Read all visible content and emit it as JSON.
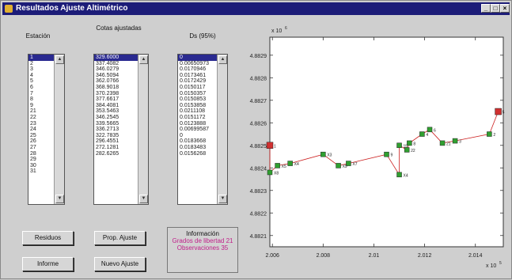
{
  "window": {
    "title": "Resultados Ajuste Altimétrico"
  },
  "labels": {
    "estacion": "Estación",
    "cotas": "Cotas ajustadas",
    "desv": "Ds (95%)"
  },
  "estacion_list": [
    "1",
    "2",
    "3",
    "4",
    "5",
    "6",
    "7",
    "8",
    "9",
    "21",
    "22",
    "23",
    "24",
    "25",
    "26",
    "27",
    "28",
    "29",
    "30",
    "31"
  ],
  "cotas_list": [
    "329.6000",
    "337.4082",
    "346.0279",
    "346.5094",
    "362.0766",
    "368.9018",
    "370.2398",
    "377.6617",
    "384.4081",
    "353.5463",
    "346.2545",
    "339.5665",
    "336.2713",
    "322.7835",
    "296.4551",
    "272.1281",
    "282.6265"
  ],
  "desv_list": [
    "0",
    "0.00650973",
    "0.0170946",
    "0.0173461",
    "0.0172429",
    "0.0150117",
    "0.0150357",
    "0.0150853",
    "0.0153858",
    "0.0211108",
    "0.0151172",
    "0.0123888",
    "0.00699587",
    "0",
    "0.0183668",
    "0.0183483",
    "0.0156268"
  ],
  "buttons": {
    "residuos": "Residuos",
    "prop_ajuste": "Prop. Ajuste",
    "informe": "Informe",
    "nuevo_ajuste": "Nuevo Ajuste"
  },
  "info": {
    "title": "Información",
    "line1": "Grados de libertad 21",
    "line2": "Observaciones 35"
  },
  "colors": {
    "info_text": "#c0208a",
    "fixed_point": "#d03030",
    "free_point": "#30a030",
    "line": "#cc2020"
  },
  "chart_data": {
    "type": "scatter",
    "x_multiplier_label": "x 10",
    "x_multiplier_exp": "5",
    "y_multiplier_label": "x 10",
    "y_multiplier_exp": "6",
    "xlim": [
      2.0059,
      2.0151
    ],
    "ylim": [
      4.88205,
      4.88298
    ],
    "x_ticks": [
      2.006,
      2.008,
      2.01,
      2.012,
      2.014
    ],
    "x_tick_labels": [
      "2.006",
      "2.008",
      "2.01",
      "2.012",
      "2.014"
    ],
    "y_ticks": [
      4.8821,
      4.8822,
      4.8823,
      4.8824,
      4.8825,
      4.8826,
      4.8827,
      4.8828,
      4.8829
    ],
    "y_tick_labels": [
      "4.8821",
      "4.8822",
      "4.8823",
      "4.8824",
      "4.8825",
      "4.8826",
      "4.8827",
      "4.8828",
      "4.8829"
    ],
    "points": [
      {
        "label": "5",
        "x": 2.0149,
        "y": 4.88265,
        "fixed": true
      },
      {
        "label": "2",
        "x": 2.01455,
        "y": 4.88255,
        "fixed": false
      },
      {
        "label": "3",
        "x": 2.0132,
        "y": 4.88252,
        "fixed": false
      },
      {
        "label": "21",
        "x": 2.0127,
        "y": 4.88251,
        "fixed": false
      },
      {
        "label": "6",
        "x": 2.0122,
        "y": 4.88257,
        "fixed": false
      },
      {
        "label": "4",
        "x": 2.0119,
        "y": 4.88255,
        "fixed": false
      },
      {
        "label": "8",
        "x": 2.0114,
        "y": 4.88251,
        "fixed": false
      },
      {
        "label": "22",
        "x": 2.0113,
        "y": 4.88248,
        "fixed": false
      },
      {
        "label": "15",
        "x": 2.011,
        "y": 4.8825,
        "fixed": false
      },
      {
        "label": "X4",
        "x": 2.011,
        "y": 4.88237,
        "fixed": false
      },
      {
        "label": "9",
        "x": 2.0105,
        "y": 4.88246,
        "fixed": false
      },
      {
        "label": "X7",
        "x": 2.009,
        "y": 4.88242,
        "fixed": false
      },
      {
        "label": "X9",
        "x": 2.0086,
        "y": 4.88241,
        "fixed": false
      },
      {
        "label": "X3",
        "x": 2.008,
        "y": 4.88246,
        "fixed": false
      },
      {
        "label": "X4",
        "x": 2.0067,
        "y": 4.88242,
        "fixed": false
      },
      {
        "label": "X5",
        "x": 2.0062,
        "y": 4.88241,
        "fixed": false
      },
      {
        "label": "X8",
        "x": 2.0059,
        "y": 4.88238,
        "fixed": false
      },
      {
        "label": "1",
        "x": 2.0059,
        "y": 4.8825,
        "fixed": true
      }
    ]
  }
}
